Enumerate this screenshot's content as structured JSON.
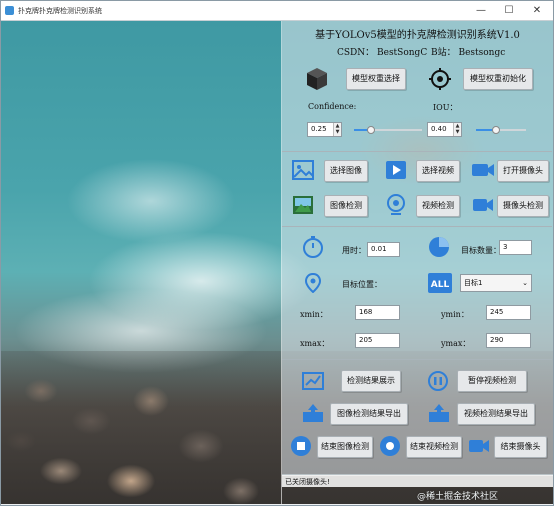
{
  "window": {
    "title": "扑克牌扑克牌检测识别系统",
    "minimize": "—",
    "maximize": "☐",
    "close": "✕"
  },
  "header": {
    "title": "基于YOLOv5模型的扑克牌检测识别系统V1.0",
    "csdn": "CSDN：  BestSongC",
    "bilibili": "B站：  Bestsongc"
  },
  "model": {
    "select_label": "模型权重选择",
    "init_label": "模型权重初始化",
    "confidence_label": "Confidence:",
    "iou_label": "IOU：",
    "confidence_value": "0.25",
    "iou_value": "0.40",
    "confidence_fraction": 0.25,
    "iou_fraction": 0.4
  },
  "source": {
    "select_image": "选择图像",
    "select_video": "选择视频",
    "open_camera": "打开摄像头",
    "image_detect": "图像检测",
    "video_detect": "视频检测",
    "camera_detect": "摄像头检测"
  },
  "results": {
    "time_label": "用时：",
    "time_value": "0.01",
    "count_label": "目标数量：",
    "count_value": "3",
    "position_label": "目标位置：",
    "target_select": "目标1",
    "xmin_label": "xmin：",
    "xmin_value": "168",
    "ymin_label": "ymin：",
    "ymin_value": "245",
    "xmax_label": "xmax：",
    "xmax_value": "205",
    "ymax_label": "ymax：",
    "ymax_value": "290"
  },
  "actions": {
    "show_results": "检测结果展示",
    "pause_video": "暂停视频检测",
    "export_image": "图像检测结果导出",
    "export_video": "视频检测结果导出",
    "end_image": "结束图像检测",
    "end_video": "结束视频检测",
    "end_camera": "结束摄像头"
  },
  "status": {
    "message": "已关闭摄像头!"
  },
  "watermark": "@稀土掘金技术社区",
  "colors": {
    "accent": "#3a8ee6",
    "icon_blue": "#2f7fd8"
  }
}
